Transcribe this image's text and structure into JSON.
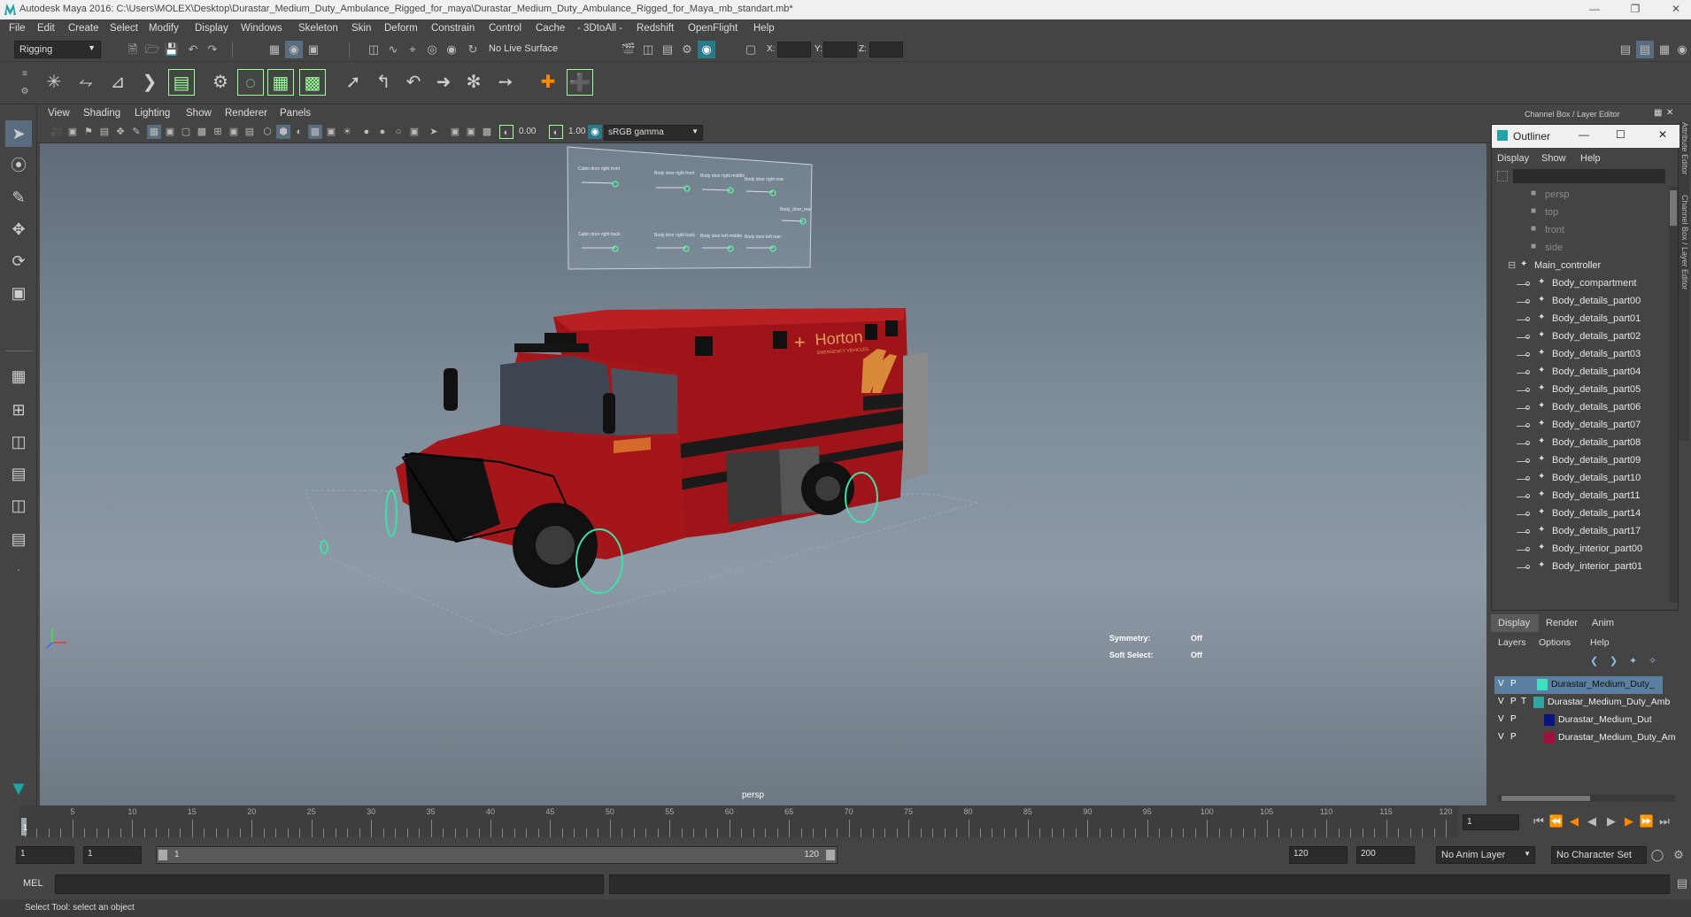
{
  "title_bar": {
    "text": "Autodesk Maya 2016: C:\\Users\\MOLEX\\Desktop\\Durastar_Medium_Duty_Ambulance_Rigged_for_maya\\Durastar_Medium_Duty_Ambulance_Rigged_for_Maya_mb_standart.mb*"
  },
  "menu": [
    "File",
    "Edit",
    "Create",
    "Select",
    "Modify",
    "Display",
    "Windows",
    "Skeleton",
    "Skin",
    "Deform",
    "Constrain",
    "Control",
    "Cache",
    "- 3DtoAll -",
    "Redshift",
    "OpenFlight",
    "Help"
  ],
  "shelf": {
    "mode": "Rigging",
    "live_surface": "No Live Surface",
    "x_label": "X:",
    "y_label": "Y:",
    "z_label": "Z:"
  },
  "viewport_menu": [
    "View",
    "Shading",
    "Lighting",
    "Show",
    "Renderer",
    "Panels"
  ],
  "viewport_toolbar": {
    "exposure": "0.00",
    "gamma": "1.00",
    "colorspace": "sRGB gamma"
  },
  "viewport": {
    "camera": "persp",
    "symmetry_label": "Symmetry:",
    "symmetry_value": "Off",
    "soft_select_label": "Soft Select:",
    "soft_select_value": "Off",
    "brand_text": "Horton",
    "brand_sub": "EMERGENCY VEHICLES"
  },
  "control_board": {
    "labels": [
      "Cabin door right front",
      "Body door right front",
      "Body door right middle",
      "Body door right rear",
      "Body_door_rear",
      "Cabin door right back",
      "Body door right back",
      "Body door left middle",
      "Body door left rear"
    ]
  },
  "channel_box": {
    "title": "Channel Box / Layer Editor",
    "side_tabs": [
      "Attribute Editor",
      "Channel Box / Layer Editor"
    ]
  },
  "outliner": {
    "title": "Outliner",
    "menu": [
      "Display",
      "Show",
      "Help"
    ],
    "items": [
      {
        "label": "persp",
        "type": "camera",
        "dim": true
      },
      {
        "label": "top",
        "type": "camera",
        "dim": true
      },
      {
        "label": "front",
        "type": "camera",
        "dim": true
      },
      {
        "label": "side",
        "type": "camera",
        "dim": true
      },
      {
        "label": "Main_controller",
        "type": "group",
        "dim": false
      },
      {
        "label": "Body_compartment",
        "type": "child",
        "dim": false
      },
      {
        "label": "Body_details_part00",
        "type": "child",
        "dim": false
      },
      {
        "label": "Body_details_part01",
        "type": "child",
        "dim": false
      },
      {
        "label": "Body_details_part02",
        "type": "child",
        "dim": false
      },
      {
        "label": "Body_details_part03",
        "type": "child",
        "dim": false
      },
      {
        "label": "Body_details_part04",
        "type": "child",
        "dim": false
      },
      {
        "label": "Body_details_part05",
        "type": "child",
        "dim": false
      },
      {
        "label": "Body_details_part06",
        "type": "child",
        "dim": false
      },
      {
        "label": "Body_details_part07",
        "type": "child",
        "dim": false
      },
      {
        "label": "Body_details_part08",
        "type": "child",
        "dim": false
      },
      {
        "label": "Body_details_part09",
        "type": "child",
        "dim": false
      },
      {
        "label": "Body_details_part10",
        "type": "child",
        "dim": false
      },
      {
        "label": "Body_details_part11",
        "type": "child",
        "dim": false
      },
      {
        "label": "Body_details_part14",
        "type": "child",
        "dim": false
      },
      {
        "label": "Body_details_part17",
        "type": "child",
        "dim": false
      },
      {
        "label": "Body_interior_part00",
        "type": "child",
        "dim": false
      },
      {
        "label": "Body_interior_part01",
        "type": "child",
        "dim": false
      }
    ]
  },
  "layer_editor": {
    "tabs": [
      "Display",
      "Render",
      "Anim"
    ],
    "menu": [
      "Layers",
      "Options",
      "Help"
    ],
    "layers": [
      {
        "v": "V",
        "p": "P",
        "t": "",
        "color": "#3fe0c0",
        "name": "Durastar_Medium_Duty_",
        "selected": true
      },
      {
        "v": "V",
        "p": "P",
        "t": "T",
        "color": "#2ea6a6",
        "name": "Durastar_Medium_Duty_Amb",
        "selected": false
      },
      {
        "v": "V",
        "p": "P",
        "t": "",
        "color": "#0a1480",
        "name": "Durastar_Medium_Dut",
        "selected": false
      },
      {
        "v": "V",
        "p": "P",
        "t": "",
        "color": "#a0103a",
        "name": "Durastar_Medium_Duty_Am",
        "selected": false
      }
    ]
  },
  "timeline": {
    "ticks": [
      "5",
      "10",
      "15",
      "20",
      "25",
      "30",
      "35",
      "40",
      "45",
      "50",
      "55",
      "60",
      "65",
      "70",
      "75",
      "80",
      "85",
      "90",
      "95",
      "100",
      "105",
      "110",
      "115",
      "120"
    ],
    "start_label": "1",
    "current_frame": "1"
  },
  "range": {
    "start": "1",
    "anim_start": "1",
    "range_start": "1",
    "range_end": "120",
    "end": "120",
    "anim_end": "200",
    "anim_layer": "No Anim Layer",
    "character_set": "No Character Set"
  },
  "command": {
    "lang": "MEL"
  },
  "help_line": "Select Tool: select an object"
}
